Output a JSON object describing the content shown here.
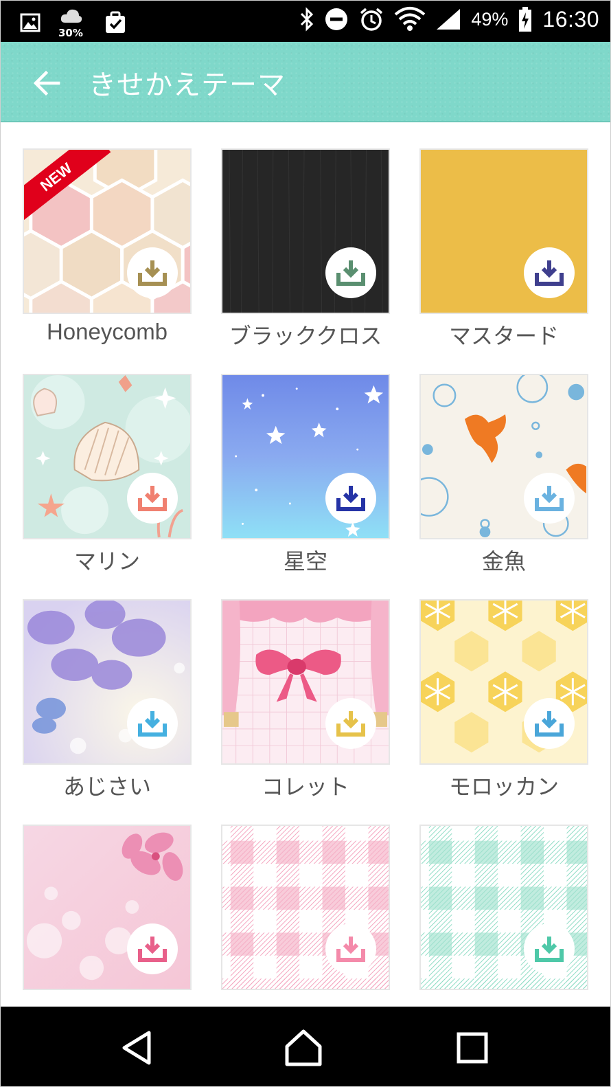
{
  "status_bar": {
    "weather_percent": "30%",
    "battery_percent": "49%",
    "time": "16:30",
    "icons_left": [
      "image-notification-icon",
      "cloud-weather-icon",
      "clipboard-check-icon"
    ],
    "icons_right": [
      "bluetooth-icon",
      "do-not-disturb-icon",
      "alarm-icon",
      "wifi-icon",
      "cell-signal-icon",
      "battery-charging-icon"
    ]
  },
  "app_bar": {
    "title": "きせかえテーマ",
    "back_icon": "arrow-left-icon",
    "background_color": "#7fd8ca"
  },
  "themes": [
    {
      "name": "Honeycomb",
      "badge": "NEW",
      "pattern": "honeycomb",
      "download_color": "#a69053"
    },
    {
      "name": "ブラッククロス",
      "pattern": "black-cloth",
      "download_color": "#5a8f70"
    },
    {
      "name": "マスタード",
      "pattern": "mustard",
      "download_color": "#3f3f8e"
    },
    {
      "name": "マリン",
      "pattern": "marine",
      "download_color": "#f08070"
    },
    {
      "name": "星空",
      "pattern": "starry-sky",
      "download_color": "#2533a6"
    },
    {
      "name": "金魚",
      "pattern": "goldfish",
      "download_color": "#6ab2e0"
    },
    {
      "name": "あじさい",
      "pattern": "hydrangea",
      "download_color": "#45b0e0"
    },
    {
      "name": "コレット",
      "pattern": "colette",
      "download_color": "#e6c24a"
    },
    {
      "name": "モロッカン",
      "pattern": "moroccan",
      "download_color": "#4aa6d9"
    },
    {
      "name": "",
      "pattern": "sakura",
      "download_color": "#e8608a"
    },
    {
      "name": "",
      "pattern": "pink-gingham",
      "download_color": "#f48aaa"
    },
    {
      "name": "",
      "pattern": "mint-gingham",
      "download_color": "#4ec8a8"
    }
  ],
  "nav_bar": {
    "buttons": [
      "back-triangle-icon",
      "home-icon",
      "recents-square-icon"
    ]
  }
}
